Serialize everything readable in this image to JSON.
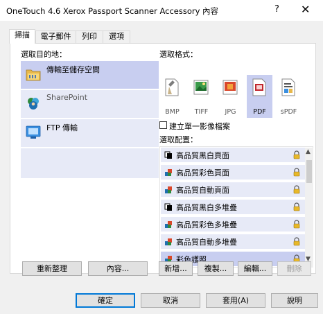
{
  "window": {
    "title": "OneTouch 4.6 Xerox Passport Scanner Accessory 內容",
    "help_glyph": "?",
    "close_glyph": "✕"
  },
  "tabs": [
    {
      "label": "掃描",
      "active": true
    },
    {
      "label": "電子郵件",
      "active": false
    },
    {
      "label": "列印",
      "active": false
    },
    {
      "label": "選項",
      "active": false
    }
  ],
  "destination": {
    "heading": "選取目的地：",
    "items": [
      {
        "label": "傳輸至儲存空間",
        "icon": "folder-icon",
        "selected": true
      },
      {
        "label": "SharePoint",
        "icon": "sharepoint-icon",
        "selected": false
      },
      {
        "label": "FTP 傳輸",
        "icon": "ftp-icon",
        "selected": false
      }
    ]
  },
  "format": {
    "heading": "選取格式：",
    "items": [
      {
        "label": "BMP",
        "icon": "bmp-icon",
        "selected": false
      },
      {
        "label": "TIFF",
        "icon": "tiff-icon",
        "selected": false
      },
      {
        "label": "JPG",
        "icon": "jpg-icon",
        "selected": false
      },
      {
        "label": "PDF",
        "icon": "pdf-icon",
        "selected": true
      },
      {
        "label": "sPDF",
        "icon": "spdf-icon",
        "selected": false
      }
    ],
    "single_image_label": "建立單一影像檔案",
    "single_image_checked": false
  },
  "configuration": {
    "heading": "選取配置：",
    "items": [
      {
        "label": "高品質黑白頁面",
        "icon": "bw-page-icon",
        "selected": false
      },
      {
        "label": "高品質彩色頁面",
        "icon": "color-page-icon",
        "selected": false
      },
      {
        "label": "高品質自動頁面",
        "icon": "color-page-icon",
        "selected": false
      },
      {
        "label": "高品質黑白多堆疊",
        "icon": "bw-page-icon",
        "selected": false
      },
      {
        "label": "高品質彩色多堆疊",
        "icon": "color-page-icon",
        "selected": false
      },
      {
        "label": "高品質自動多堆疊",
        "icon": "color-page-icon",
        "selected": false
      },
      {
        "label": "彩色護照",
        "icon": "color-page-icon",
        "selected": true
      }
    ]
  },
  "panel_buttons": {
    "refresh": "重新整理",
    "properties": "內容...",
    "new": "新增...",
    "copy": "複製...",
    "edit": "編輯...",
    "delete": "刪除"
  },
  "footer_buttons": {
    "ok": "確定",
    "cancel": "取消",
    "apply": "套用(A)",
    "help": "說明"
  },
  "colors": {
    "selection": "#c8cef0",
    "list_background": "#e7eaf7",
    "default_button_border": "#0078d7"
  }
}
